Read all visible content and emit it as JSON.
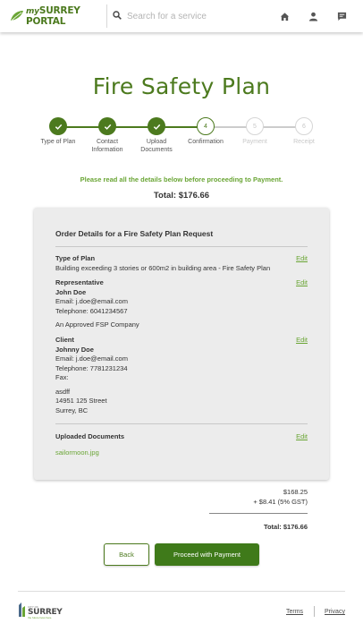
{
  "header": {
    "logo_my": "my",
    "logo_text": "SURREY PORTAL",
    "search_placeholder": "Search for a service",
    "icons": [
      "home-icon",
      "user-icon",
      "message-icon"
    ]
  },
  "page": {
    "title": "Fire Safety Plan",
    "notice": "Please read all the details below before proceeding to Payment.",
    "total_top": "Total: $176.66"
  },
  "stepper": {
    "steps": [
      {
        "label": "Type of Plan",
        "state": "done"
      },
      {
        "label": "Contact Information",
        "state": "done"
      },
      {
        "label": "Upload Documents",
        "state": "done"
      },
      {
        "label": "Confirmation",
        "number": "4",
        "state": "current"
      },
      {
        "label": "Payment",
        "number": "5",
        "state": "future"
      },
      {
        "label": "Receipt",
        "number": "6",
        "state": "future"
      }
    ]
  },
  "order": {
    "title": "Order Details for a Fire Safety Plan Request",
    "edit_label": "Edit",
    "type_of_plan": {
      "label": "Type of Plan",
      "value": "Building exceeding 3 stories or 600m2 in building area - Fire Safety Plan"
    },
    "representative": {
      "label": "Representative",
      "name": "John Doe",
      "email": "Email: j.doe@email.com",
      "telephone": "Telephone: 6041234567",
      "company": "An Approved FSP Company"
    },
    "client": {
      "label": "Client",
      "name": "Johnny Doe",
      "email": "Email: j.doe@email.com",
      "telephone": "Telephone: 7781231234",
      "fax": "Fax:",
      "address_line1": "asdff",
      "address_line2": "14951 125 Street",
      "address_line3": "Surrey, BC"
    },
    "documents": {
      "label": "Uploaded Documents",
      "file": "sailormoon.jpg"
    }
  },
  "totals": {
    "subtotal": "$168.25",
    "gst": "+ $8.41 (5% GST)",
    "total": "Total: $176.66"
  },
  "buttons": {
    "back": "Back",
    "proceed": "Proceed with Payment"
  },
  "footer": {
    "logo_city": "CITY OF",
    "logo_word": "SURREY",
    "logo_tagline": "the future lives here.",
    "terms": "Terms",
    "privacy": "Privacy"
  },
  "colors": {
    "brand_green": "#4c7a1e",
    "accent_green": "#6aa535",
    "button_green": "#3f7a1a"
  }
}
